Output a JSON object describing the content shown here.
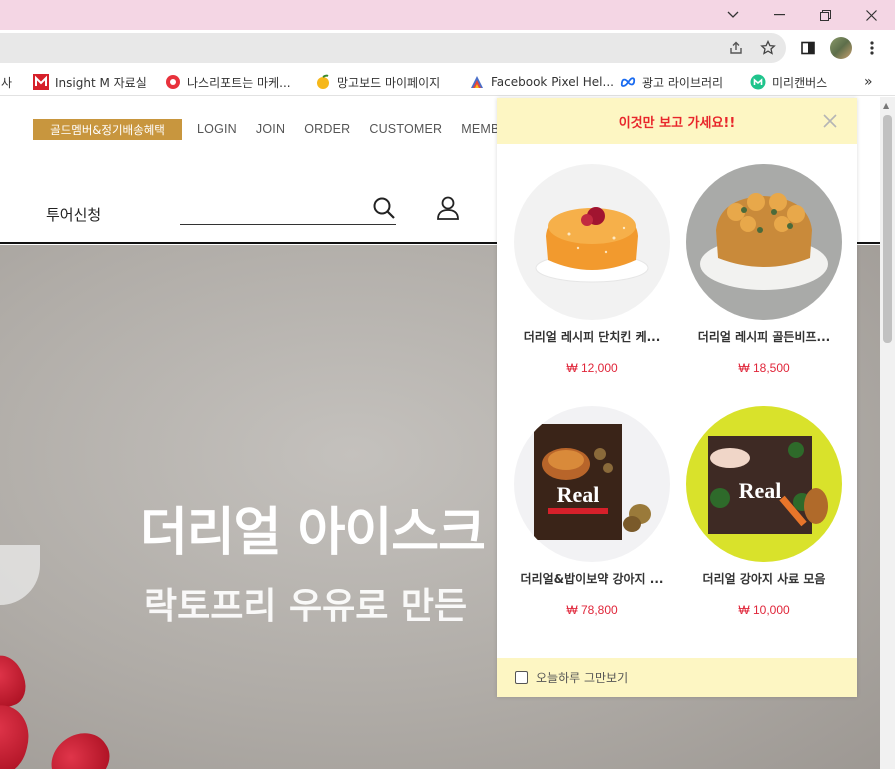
{
  "browser": {
    "bookmarks": [
      {
        "label": "행사",
        "icon": "folder-icon"
      },
      {
        "label": "Insight M 자료실",
        "icon": "m-logo-icon"
      },
      {
        "label": "나스리포트는 마케...",
        "icon": "red-circle-icon"
      },
      {
        "label": "망고보드 마이페이지",
        "icon": "mango-icon"
      },
      {
        "label": "Facebook Pixel Hel...",
        "icon": "pixel-helper-icon"
      },
      {
        "label": "광고 라이브러리",
        "icon": "meta-icon"
      },
      {
        "label": "미리캔버스",
        "icon": "miricanvas-icon"
      }
    ],
    "more_bookmarks": "»"
  },
  "site": {
    "gold_badge": "골드멤버&정기배송혜택",
    "nav": [
      "LOGIN",
      "JOIN",
      "ORDER",
      "CUSTOMER",
      "MEMBER"
    ],
    "tour_label": "투어신청",
    "hero_title": "더리얼 아이스크",
    "hero_subtitle": "락토프리 우유로 만든"
  },
  "popup": {
    "title": "이것만 보고 가세요!!",
    "products": [
      {
        "name": "더리얼 레시피 단치킨 케...",
        "price": "₩ 12,000"
      },
      {
        "name": "더리얼 레시피 골든비프...",
        "price": "₩ 18,500"
      },
      {
        "name": "더리얼&밥이보약 강아지 ...",
        "price": "₩ 78,800"
      },
      {
        "name": "더리얼 강아지 사료 모음",
        "price": "₩ 10,000"
      }
    ],
    "footer_label": "오늘하루 그만보기"
  }
}
